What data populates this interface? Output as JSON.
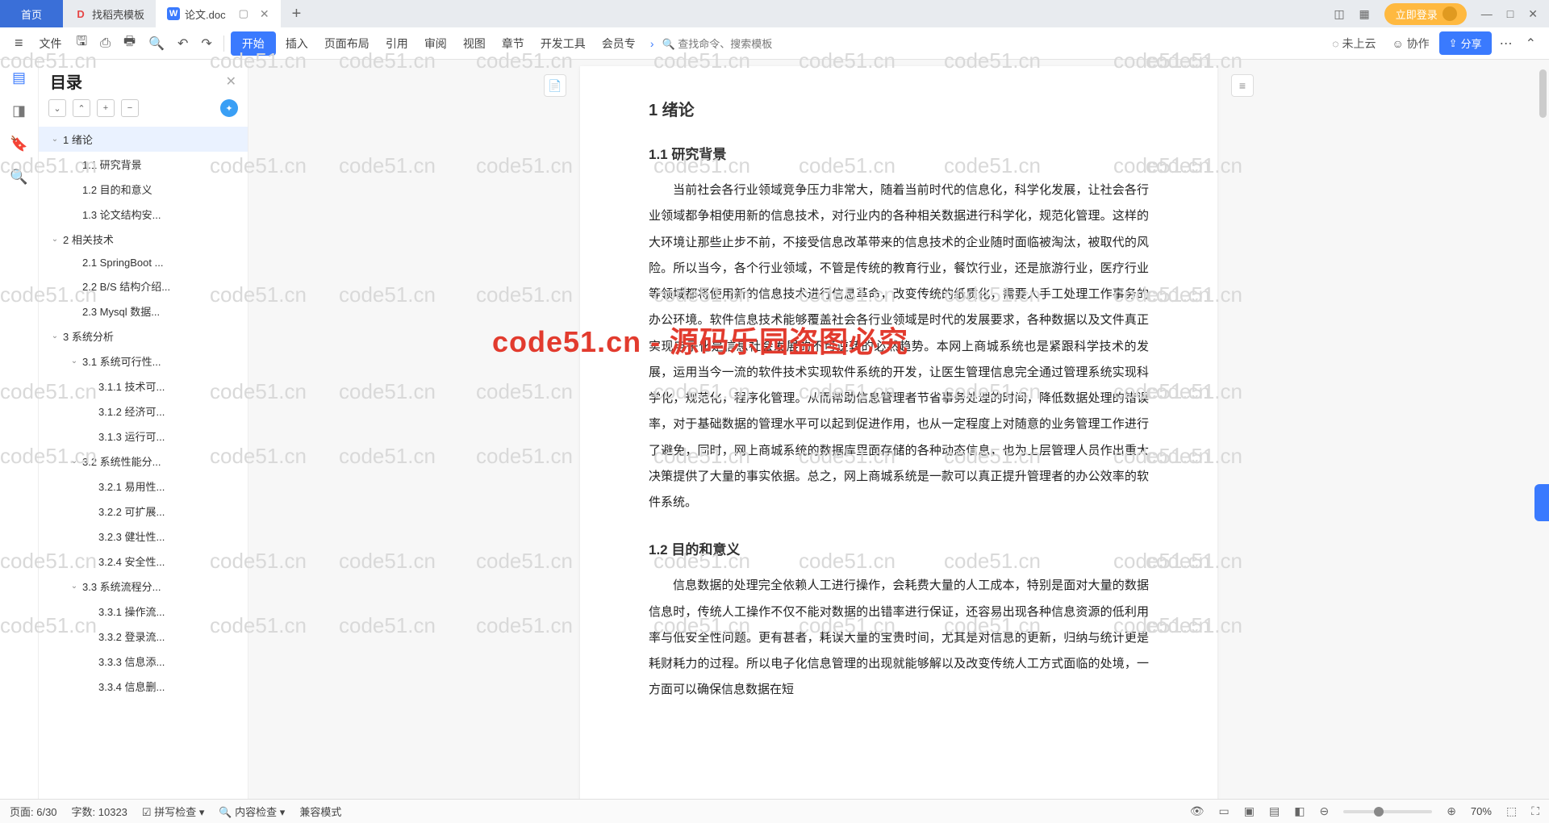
{
  "tabs": {
    "home": "首页",
    "t1": "找稻壳模板",
    "t2": "论文.doc",
    "add": "+"
  },
  "login": "立即登录",
  "ribbon": {
    "file": "文件",
    "start": "开始",
    "insert": "插入",
    "layout": "页面布局",
    "ref": "引用",
    "review": "审阅",
    "view": "视图",
    "chapter": "章节",
    "dev": "开发工具",
    "member": "会员专",
    "search": "查找命令、搜索模板",
    "cloud": "未上云",
    "coop": "协作",
    "share": "分享"
  },
  "outline": {
    "title": "目录",
    "items": [
      {
        "lvl": 1,
        "chev": "⌄",
        "label": "1  绪论",
        "active": true
      },
      {
        "lvl": 2,
        "chev": "",
        "label": "1.1  研究背景"
      },
      {
        "lvl": 2,
        "chev": "",
        "label": "1.2  目的和意义"
      },
      {
        "lvl": 2,
        "chev": "",
        "label": "1.3  论文结构安..."
      },
      {
        "lvl": 1,
        "chev": "⌄",
        "label": "2  相关技术"
      },
      {
        "lvl": 2,
        "chev": "",
        "label": "2.1  SpringBoot ..."
      },
      {
        "lvl": 2,
        "chev": "",
        "label": "2.2  B/S 结构介绍..."
      },
      {
        "lvl": 2,
        "chev": "",
        "label": "2.3  Mysql 数据..."
      },
      {
        "lvl": 1,
        "chev": "⌄",
        "label": "3  系统分析"
      },
      {
        "lvl": 2,
        "chev": "⌄",
        "label": "3.1  系统可行性..."
      },
      {
        "lvl": 3,
        "chev": "",
        "label": "3.1.1  技术可..."
      },
      {
        "lvl": 3,
        "chev": "",
        "label": "3.1.2  经济可..."
      },
      {
        "lvl": 3,
        "chev": "",
        "label": "3.1.3  运行可..."
      },
      {
        "lvl": 2,
        "chev": "⌄",
        "label": "3.2  系统性能分..."
      },
      {
        "lvl": 3,
        "chev": "",
        "label": "3.2.1  易用性..."
      },
      {
        "lvl": 3,
        "chev": "",
        "label": "3.2.2  可扩展..."
      },
      {
        "lvl": 3,
        "chev": "",
        "label": "3.2.3  健壮性..."
      },
      {
        "lvl": 3,
        "chev": "",
        "label": "3.2.4  安全性..."
      },
      {
        "lvl": 2,
        "chev": "⌄",
        "label": "3.3  系统流程分..."
      },
      {
        "lvl": 3,
        "chev": "",
        "label": "3.3.1  操作流..."
      },
      {
        "lvl": 3,
        "chev": "",
        "label": "3.3.2  登录流..."
      },
      {
        "lvl": 3,
        "chev": "",
        "label": "3.3.3  信息添..."
      },
      {
        "lvl": 3,
        "chev": "",
        "label": "3.3.4  信息删..."
      }
    ]
  },
  "doc": {
    "h1": "1  绪论",
    "h2a": "1.1  研究背景",
    "p1": "当前社会各行业领域竞争压力非常大，随着当前时代的信息化，科学化发展，让社会各行业领域都争相使用新的信息技术，对行业内的各种相关数据进行科学化，规范化管理。这样的大环境让那些止步不前，不接受信息改革带来的信息技术的企业随时面临被淘汰，被取代的风险。所以当今，各个行业领域，不管是传统的教育行业，餐饮行业，还是旅游行业，医疗行业等领域都将使用新的信息技术进行信息革命，改变传统的纸质化，需要人手工处理工作事务的办公环境。软件信息技术能够覆盖社会各行业领域是时代的发展要求，各种数据以及文件真正实现电子化是信息社会发展的不可逆转的必然趋势。本网上商城系统也是紧跟科学技术的发展，运用当今一流的软件技术实现软件系统的开发，让医生管理信息完全通过管理系统实现科学化，规范化，程序化管理。从而帮助信息管理者节省事务处理的时间，降低数据处理的错误率，对于基础数据的管理水平可以起到促进作用，也从一定程度上对随意的业务管理工作进行了避免，同时，网上商城系统的数据库里面存储的各种动态信息，也为上层管理人员作出重大决策提供了大量的事实依据。总之，网上商城系统是一款可以真正提升管理者的办公效率的软件系统。",
    "h2b": "1.2  目的和意义",
    "p2": "信息数据的处理完全依赖人工进行操作，会耗费大量的人工成本，特别是面对大量的数据信息时，传统人工操作不仅不能对数据的出错率进行保证，还容易出现各种信息资源的低利用率与低安全性问题。更有甚者，耗误大量的宝贵时间，尤其是对信息的更新，归纳与统计更是耗财耗力的过程。所以电子化信息管理的出现就能够解以及改变传统人工方式面临的处境，一方面可以确保信息数据在短"
  },
  "status": {
    "page": "页面: 6/30",
    "words": "字数: 10323",
    "spell": "拼写检查",
    "content": "内容检查",
    "compat": "兼容模式",
    "zoom": "70%"
  },
  "wm": {
    "grey": "code51.cn",
    "red": "code51.cn - 源码乐园盗图必究"
  }
}
